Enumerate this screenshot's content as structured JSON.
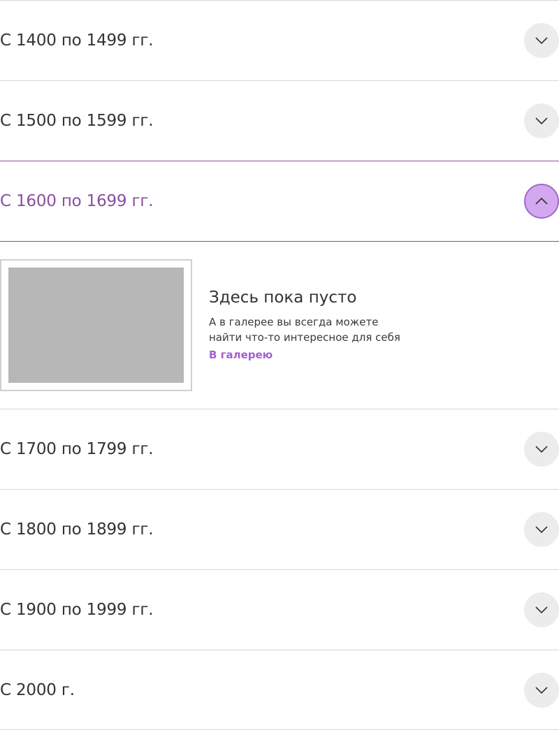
{
  "accordion": {
    "items": [
      {
        "label": "С 1400 по 1499 гг.",
        "expanded": false
      },
      {
        "label": "С 1500 по 1599 гг.",
        "expanded": false
      },
      {
        "label": "С 1600 по 1699 гг.",
        "expanded": true
      },
      {
        "label": "С 1700 по 1799 гг.",
        "expanded": false
      },
      {
        "label": "С 1800 по 1899 гг.",
        "expanded": false
      },
      {
        "label": "С 1900 по 1999 гг.",
        "expanded": false
      },
      {
        "label": "С 2000 г.",
        "expanded": false
      }
    ],
    "toggle_icon_collapsed": "chevron-down-icon",
    "toggle_icon_expanded": "chevron-up-icon"
  },
  "empty_state": {
    "title": "Здесь пока пусто",
    "text_line1": "А в галерее вы всегда можете",
    "text_line2": "найти что-то интересное для себя",
    "link_label": "В галерею"
  },
  "colors": {
    "accent": "#8a4ea0",
    "link": "#a35fd0",
    "toggle_active_bg": "#d3a8f0",
    "toggle_bg": "#ececec",
    "placeholder_image": "#b7b7b7",
    "divider": "#d6d6d6"
  }
}
